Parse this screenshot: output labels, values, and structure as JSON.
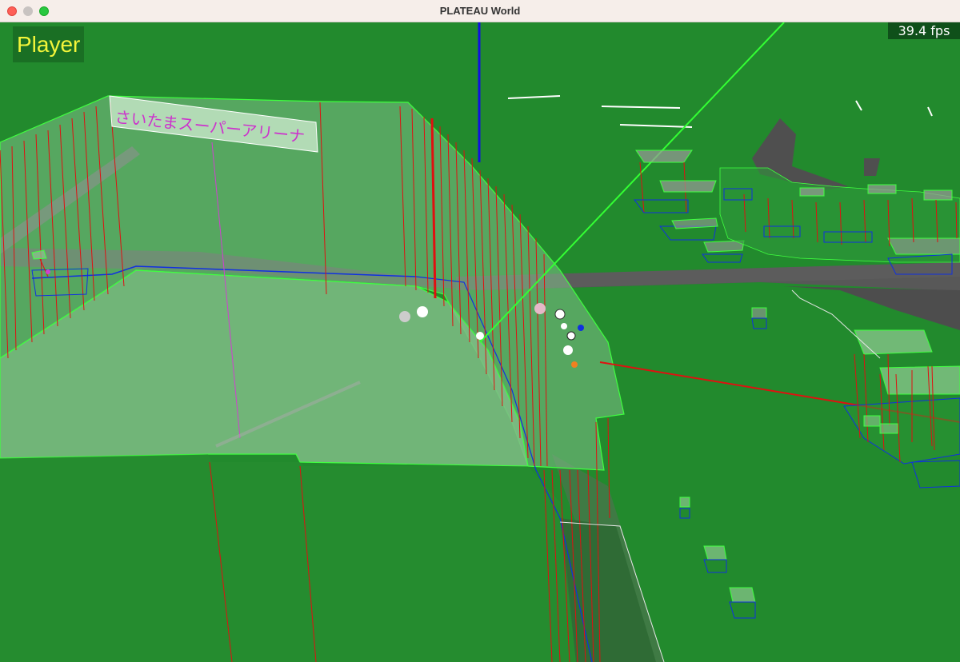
{
  "window": {
    "title": "PLATEAU World",
    "controls": [
      "close",
      "minimize",
      "zoom"
    ]
  },
  "hud": {
    "player_label": "Player",
    "fps_text": "39.4 fps"
  },
  "scene": {
    "building_label": "さいたまスーパーアリーナ",
    "colors": {
      "ground": "#228a2d",
      "road": "#555555",
      "building_fill": "#7fbf87",
      "edge_green": "#3fff3f",
      "edge_red": "#e01010",
      "edge_blue": "#1030e0",
      "axis_blue": "#1010e0",
      "label_text": "#cc33cc"
    }
  }
}
